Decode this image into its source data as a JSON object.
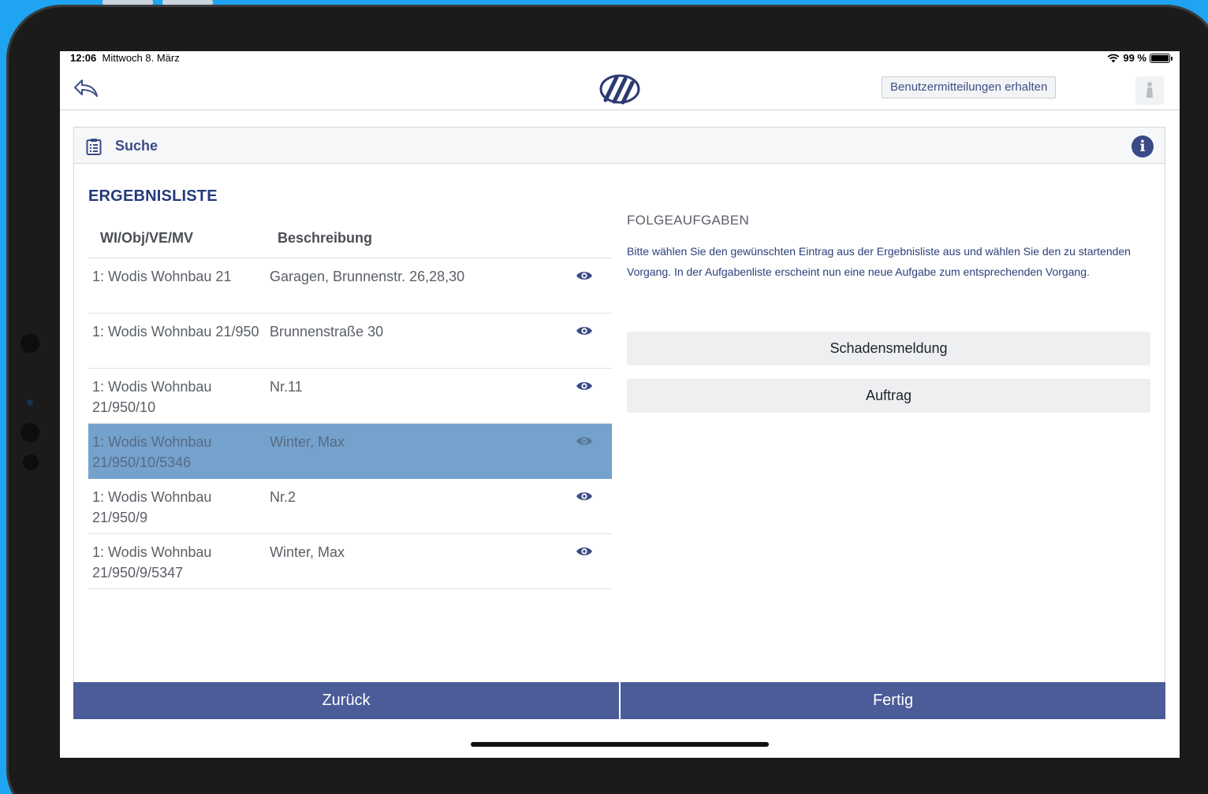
{
  "status_bar": {
    "time": "12:06",
    "date": "Mittwoch 8. März",
    "battery": "99 %"
  },
  "navbar": {
    "notify_button": "Benutzermitteilungen erhalten"
  },
  "card": {
    "title": "Suche"
  },
  "results": {
    "title": "ERGEBNISLISTE",
    "columns": [
      "WI/Obj/VE/MV",
      "Beschreibung"
    ],
    "rows": [
      {
        "id": "1: Wodis Wohnbau 21",
        "description": "Garagen, Brunnenstr. 26,28,30",
        "selected": false
      },
      {
        "id": "1: Wodis Wohnbau 21/950",
        "description": "Brunnenstraße 30",
        "selected": false
      },
      {
        "id": "1: Wodis Wohnbau 21/950/10",
        "description": "Nr.11",
        "selected": false
      },
      {
        "id": "1: Wodis Wohnbau 21/950/10/5346",
        "description": "Winter, Max",
        "selected": true
      },
      {
        "id": "1: Wodis Wohnbau 21/950/9",
        "description": "Nr.2",
        "selected": false
      },
      {
        "id": "1: Wodis Wohnbau 21/950/9/5347",
        "description": "Winter, Max",
        "selected": false
      }
    ]
  },
  "followup": {
    "title": "FOLGEAUFGABEN",
    "text": "Bitte wählen Sie den gewünschten Eintrag aus der Ergebnisliste aus und wählen Sie den zu startenden Vorgang. In der Aufgabenliste erscheint nun eine neue Aufgabe zum entsprechenden Vorgang.",
    "actions": [
      "Schadensmeldung",
      "Auftrag"
    ]
  },
  "footer": {
    "back": "Zurück",
    "done": "Fertig"
  },
  "colors": {
    "accent": "#4b5c99",
    "title_blue": "#243a7a",
    "selected_row": "#74a2cc",
    "background": "#1ea4f0"
  }
}
